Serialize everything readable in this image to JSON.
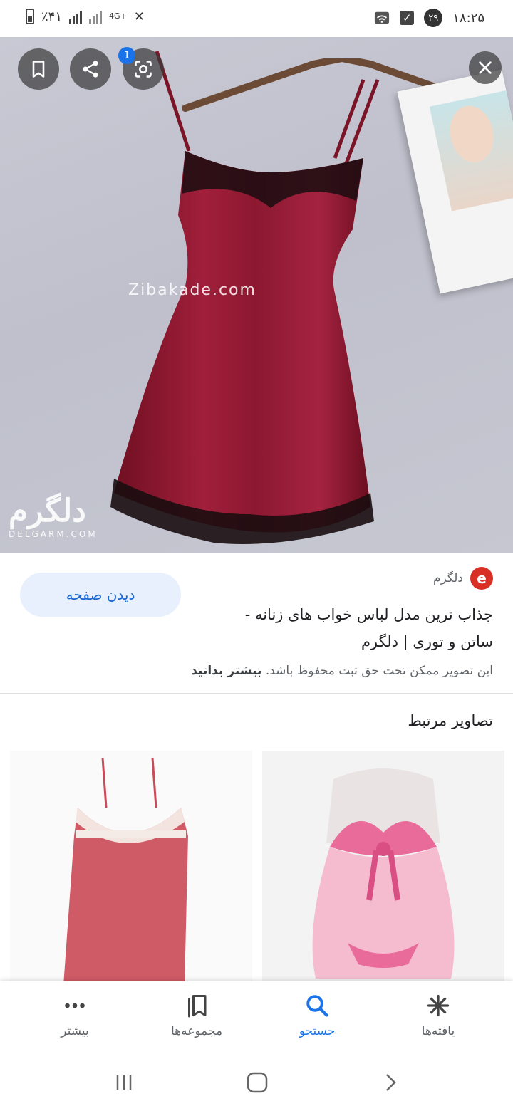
{
  "status_bar": {
    "battery": "٪۴۱",
    "network": "4G+",
    "time": "۱۸:۲۵",
    "notification_count": "۲۹"
  },
  "hero": {
    "watermark_center": "Zibakade.com",
    "watermark_logo": "دلگرم",
    "watermark_logo_sub": "DELGARM.COM",
    "share_badge": "1"
  },
  "result": {
    "site_name": "دلگرم",
    "site_icon_letter": "e",
    "title": "جذاب ترین مدل لباس خواب های زنانه - ساتن و توری | دلگرم",
    "visit_button": "دیدن صفحه",
    "copyright_text": "این تصویر ممکن تحت حق ثبت محفوظ باشد.",
    "learn_more": "بیشتر بدانید"
  },
  "related": {
    "title": "تصاویر مرتبط"
  },
  "bottom_nav": {
    "items": [
      {
        "label": "یافته‌ها",
        "icon": "discover-icon"
      },
      {
        "label": "جستجو",
        "icon": "search-icon"
      },
      {
        "label": "مجموعه‌ها",
        "icon": "collections-icon"
      },
      {
        "label": "بیشتر",
        "icon": "more-icon"
      }
    ],
    "active_index": 1
  },
  "colors": {
    "accent": "#1a73e8",
    "visit_bg": "#e8f0fe",
    "site_icon": "#d93025"
  }
}
